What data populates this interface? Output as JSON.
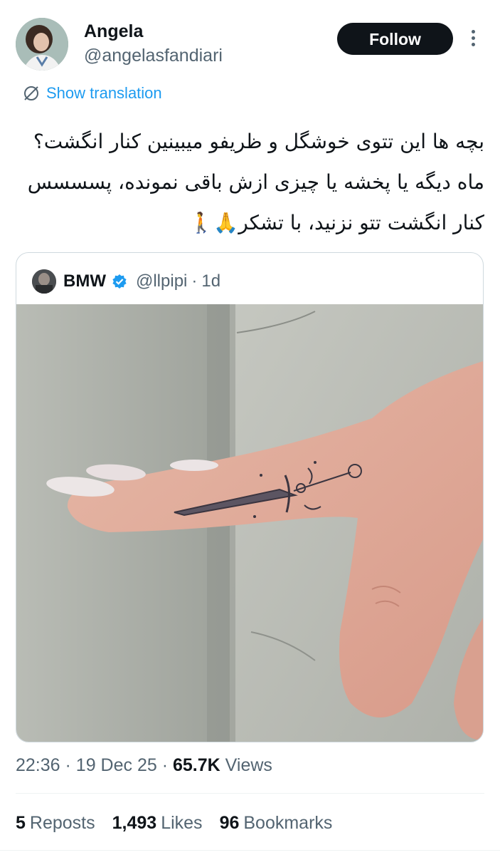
{
  "author": {
    "name": "Angela",
    "handle": "@angelasfandiari",
    "follow_label": "Follow"
  },
  "translation": {
    "label": "Show translation",
    "icon": "translate-icon"
  },
  "tweet": {
    "lines": [
      "بچه ها این تتوی خوشگل و ظریفو میبینین کنار انگشت؟",
      "ماه دیگه یا پخشه یا چیزی ازش باقی نمونده، پسسسس",
      "کنار انگشت تتو نزنید، با تشکر🙏🚶"
    ]
  },
  "quoted": {
    "name": "BMW",
    "verified": true,
    "handle": "@llpipi",
    "separator": "·",
    "time": "1d",
    "media": "photo of a hand with a small dagger tattoo on the side of the index finger"
  },
  "meta": {
    "time": "22:36",
    "sep1": "·",
    "date": "19 Dec 25",
    "sep2": "·",
    "views_count": "65.7K",
    "views_label": "Views"
  },
  "stats": [
    {
      "count": "5",
      "label": "Reposts"
    },
    {
      "count": "1,493",
      "label": "Likes"
    },
    {
      "count": "96",
      "label": "Bookmarks"
    }
  ],
  "colors": {
    "accent": "#1d9bf0",
    "text": "#0f1419",
    "muted": "#536471",
    "button_bg": "#0f1419"
  }
}
